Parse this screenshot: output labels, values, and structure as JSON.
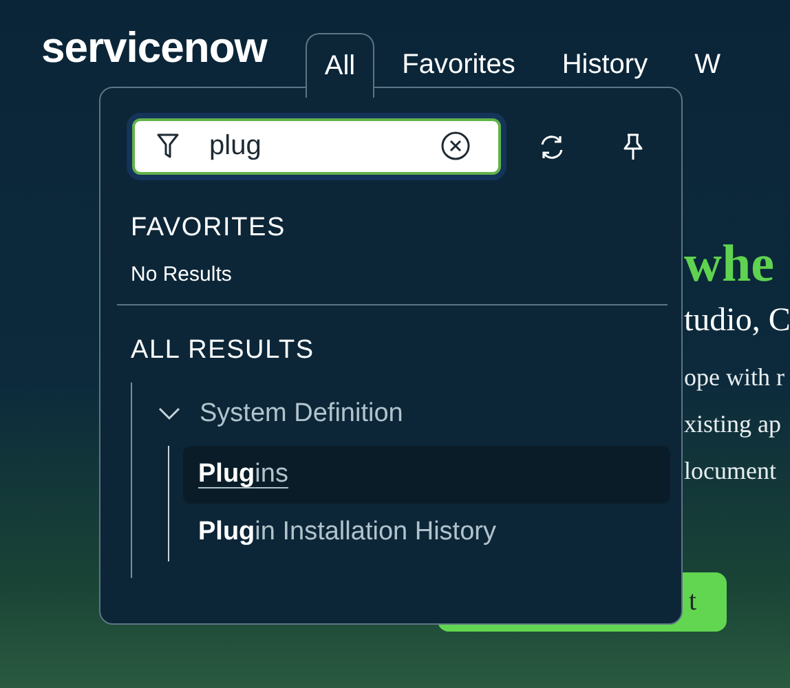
{
  "logo": "servicenow",
  "tabs": [
    {
      "label": "All",
      "selected": true
    },
    {
      "label": "Favorites",
      "selected": false
    },
    {
      "label": "History",
      "selected": false
    },
    {
      "label": "W",
      "selected": false
    }
  ],
  "background_page": {
    "heading": "whe",
    "subheading": "tudio, C",
    "lines": [
      "ope with r",
      "xisting ap",
      "locument"
    ],
    "button": "t"
  },
  "menu": {
    "search": {
      "value": "plug"
    },
    "favorites": {
      "title": "FAVORITES",
      "empty": "No Results"
    },
    "all_results": {
      "title": "ALL RESULTS",
      "groups": [
        {
          "label": "System Definition",
          "expanded": true,
          "children": [
            {
              "label": "**Plug**ins",
              "selected": true
            },
            {
              "label": "**Plug**in Installation History",
              "selected": false
            }
          ]
        }
      ]
    }
  }
}
